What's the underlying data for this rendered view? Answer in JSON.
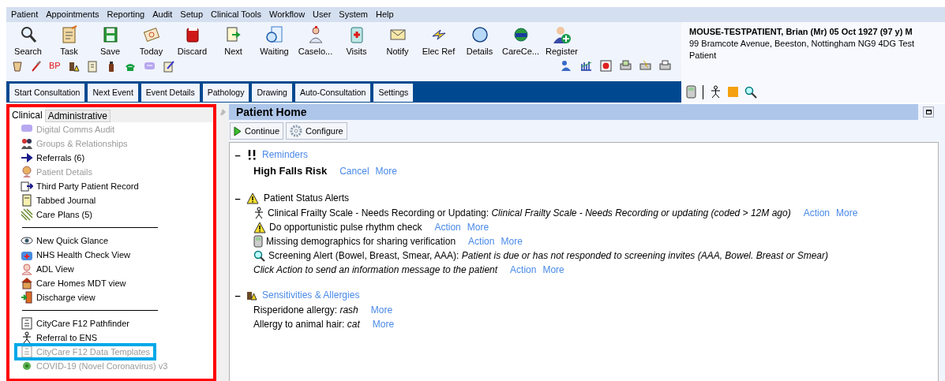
{
  "menu": [
    "Patient",
    "Appointments",
    "Reporting",
    "Audit",
    "Setup",
    "Clinical Tools",
    "Workflow",
    "User",
    "System",
    "Help"
  ],
  "toolbar": [
    "Search",
    "Task",
    "Save",
    "Today",
    "Discard",
    "Next",
    "Waiting",
    "Caselo...",
    "Visits",
    "Notify",
    "Elec Ref",
    "Details",
    "CareCe...",
    "Register"
  ],
  "quick_icons": [
    "BP"
  ],
  "action_tabs": [
    "Start Consultation",
    "Next Event",
    "Event Details",
    "Pathology",
    "Drawing",
    "Auto-Consultation",
    "Settings"
  ],
  "patient": {
    "name": "MOUSE-TESTPATIENT, Brian (Mr) 05 Oct 1927 (97 y) M",
    "address": "99 Bramcote Avenue, Beeston, Nottingham NG9 4DG  Test Patient"
  },
  "left_tabs": [
    {
      "label": "Clinical",
      "selected": true
    },
    {
      "label": "Administrative",
      "selected": false
    }
  ],
  "sidebar_items": [
    {
      "kind": "item",
      "label": "Digital Comms Audit",
      "disabled": true,
      "highlighted": false
    },
    {
      "kind": "item",
      "label": "Groups & Relationships",
      "disabled": true,
      "highlighted": false
    },
    {
      "kind": "item",
      "label": "Referrals (6)",
      "disabled": false,
      "highlighted": false
    },
    {
      "kind": "item",
      "label": "Patient Details",
      "disabled": true,
      "highlighted": false
    },
    {
      "kind": "item",
      "label": "Third Party Patient Record",
      "disabled": false,
      "highlighted": false
    },
    {
      "kind": "item",
      "label": "Tabbed Journal",
      "disabled": false,
      "highlighted": false
    },
    {
      "kind": "item",
      "label": "Care Plans (5)",
      "disabled": false,
      "highlighted": false
    },
    {
      "kind": "separator"
    },
    {
      "kind": "item",
      "label": "New Quick Glance",
      "disabled": false,
      "highlighted": false
    },
    {
      "kind": "item",
      "label": "NHS Health Check View",
      "disabled": false,
      "highlighted": false
    },
    {
      "kind": "item",
      "label": "ADL View",
      "disabled": false,
      "highlighted": false
    },
    {
      "kind": "item",
      "label": "Care Homes MDT view",
      "disabled": false,
      "highlighted": false
    },
    {
      "kind": "item",
      "label": "Discharge view",
      "disabled": false,
      "highlighted": false
    },
    {
      "kind": "separator"
    },
    {
      "kind": "item",
      "label": "CityCare F12 Pathfinder",
      "disabled": false,
      "highlighted": false
    },
    {
      "kind": "item",
      "label": "Referral to ENS",
      "disabled": false,
      "highlighted": false
    },
    {
      "kind": "item",
      "label": "CityCare F12 Data Templates",
      "disabled": true,
      "highlighted": true
    },
    {
      "kind": "item",
      "label": "COVID-19 (Novel Coronavirus) v3",
      "disabled": true,
      "highlighted": false
    }
  ],
  "panel": {
    "title": "Patient Home",
    "buttons": [
      "Continue",
      "Configure"
    ],
    "sections": [
      {
        "title": "Reminders",
        "title_link": true,
        "toggle": "–",
        "items": [
          {
            "kind": "reminder",
            "text": "High Falls Risk",
            "links": [
              "Cancel",
              "More"
            ]
          }
        ]
      },
      {
        "title": "Patient Status Alerts",
        "title_link": false,
        "toggle": "–",
        "items": [
          {
            "kind": "alert",
            "text": "Clinical Frailty Scale - Needs Recording or Updating: *Clinical Frailty Scale - Needs Recording or updating (coded > 12M ago)*",
            "links": [
              "Action",
              "More"
            ]
          },
          {
            "kind": "alert",
            "text": "Do opportunistic pulse rhythm check",
            "links": [
              "Action",
              "More"
            ]
          },
          {
            "kind": "alert",
            "text": "Missing demographics for sharing verification",
            "links": [
              "Action",
              "More"
            ]
          },
          {
            "kind": "alert",
            "text": "Screening Alert (Bowel, Breast, Smear, AAA): *Patient is due or has not responded to screening invites (AAA, Bowel. Breast or Smear)*"
          },
          {
            "kind": "note",
            "text": "Click Action to send an information message to the patient",
            "links": [
              "Action",
              "More"
            ]
          }
        ]
      },
      {
        "title": "Sensitivities & Allergies",
        "title_link": true,
        "toggle": "–",
        "items": [
          {
            "kind": "allergy",
            "text": "Risperidone allergy: *rash*",
            "links": [
              "More"
            ]
          },
          {
            "kind": "allergy",
            "text": "Allergy to animal hair: *cat*",
            "links": [
              "More"
            ]
          }
        ]
      }
    ]
  }
}
